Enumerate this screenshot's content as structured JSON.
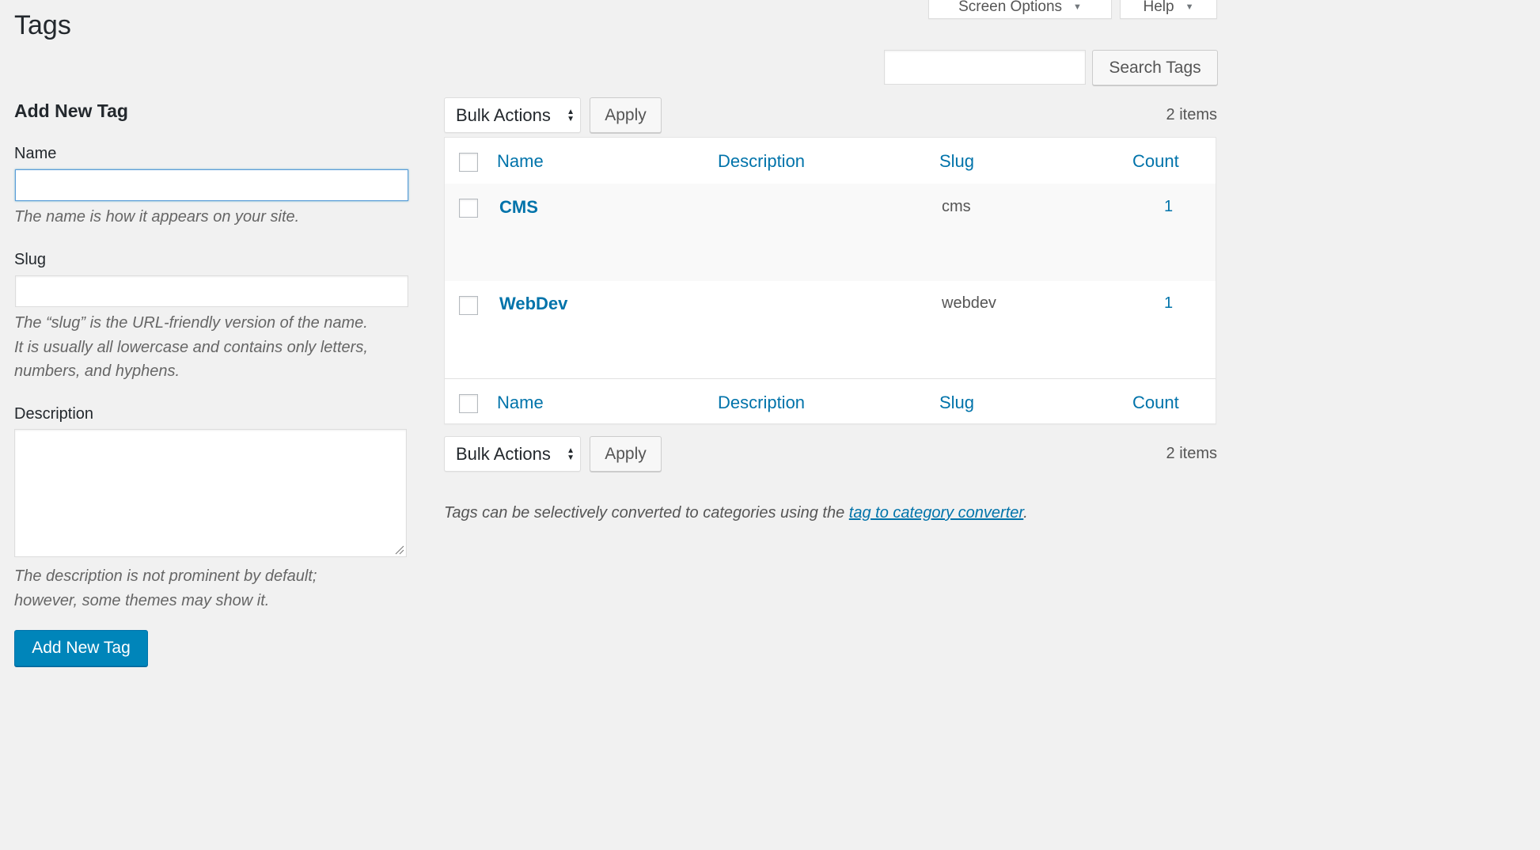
{
  "screen_meta": {
    "screen_options": "Screen Options",
    "help": "Help"
  },
  "page_title": "Tags",
  "search": {
    "button": "Search Tags",
    "value": ""
  },
  "form": {
    "heading": "Add New Tag",
    "name_label": "Name",
    "name_help": "The name is how it appears on your site.",
    "slug_label": "Slug",
    "slug_help_lines": [
      "The “slug” is the URL-friendly version of the name.",
      "It is usually all lowercase and contains only letters,",
      "numbers, and hyphens."
    ],
    "description_label": "Description",
    "description_help_lines": [
      "The description is not prominent by default;",
      "however, some themes may show it."
    ],
    "submit": "Add New Tag"
  },
  "bulk": {
    "select": "Bulk Actions",
    "apply": "Apply",
    "items": "2 items"
  },
  "table": {
    "columns": {
      "name": "Name",
      "description": "Description",
      "slug": "Slug",
      "count": "Count"
    },
    "rows": [
      {
        "name": "CMS",
        "description": "",
        "slug": "cms",
        "count": "1"
      },
      {
        "name": "WebDev",
        "description": "",
        "slug": "webdev",
        "count": "1"
      }
    ]
  },
  "note": {
    "before": "Tags can be selectively converted to categories using the ",
    "link": "tag to category converter",
    "after": "."
  }
}
